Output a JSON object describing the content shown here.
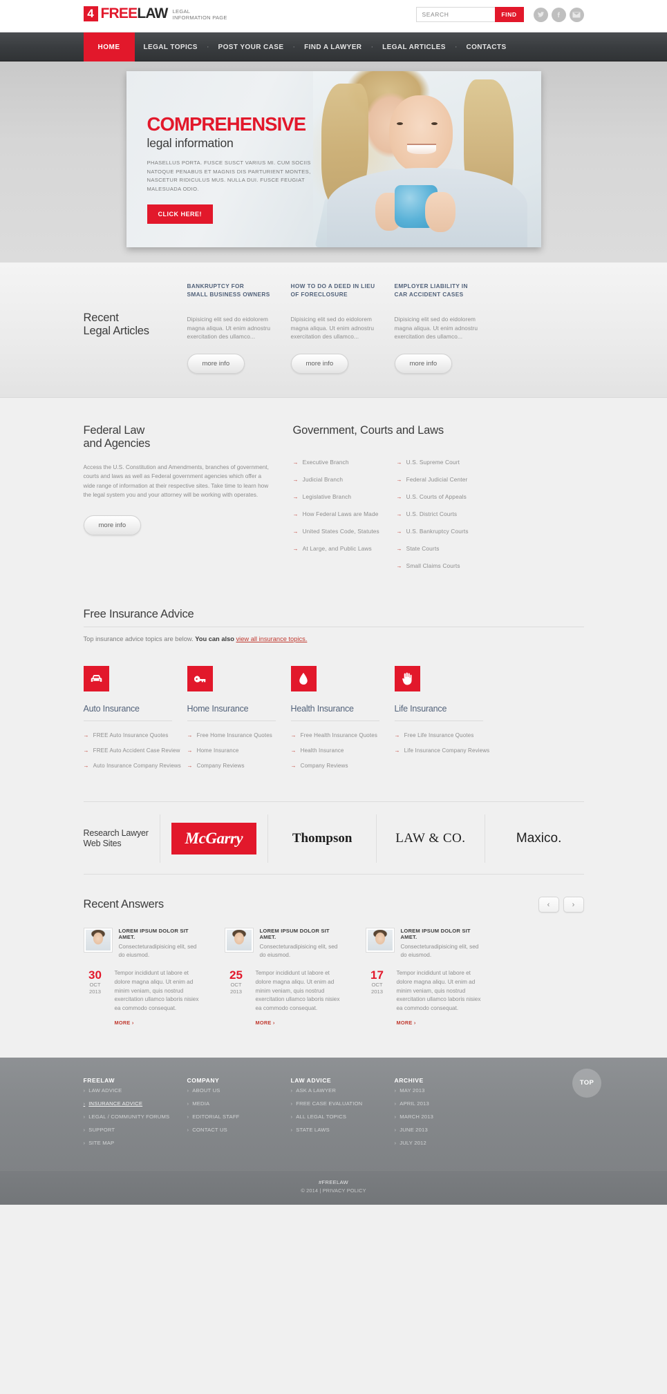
{
  "header": {
    "logo": {
      "mark": "4",
      "free": "FREE",
      "law": "LAW",
      "sub_line1": "LEGAL",
      "sub_line2": "INFORMATION PAGE"
    },
    "search": {
      "placeholder": "SEARCH",
      "value": "",
      "button": "FIND"
    },
    "social": [
      {
        "name": "twitter-icon",
        "label": "Twitter"
      },
      {
        "name": "facebook-icon",
        "label": "Facebook"
      },
      {
        "name": "email-icon",
        "label": "Email"
      }
    ]
  },
  "nav": {
    "home": "HOME",
    "items": [
      "LEGAL TOPICS",
      "POST YOUR CASE",
      "FIND A LAWYER",
      "LEGAL ARTICLES",
      "CONTACTS"
    ],
    "separator": "·"
  },
  "hero": {
    "heading": "COMPREHENSIVE",
    "subheading": "legal information",
    "paragraph": "PHASELLUS PORTA. FUSCE SUSCT VARIUS MI. CUM SOCIIS NATOQUE PENABUS ET MAGNIS DIS PARTURIENT MONTES, NASCETUR RIDICULUS MUS. NULLA DUI. FUSCE FEUGIAT MALESUADA ODIO.",
    "button": "CLICK HERE!"
  },
  "recent_articles": {
    "title_line1": "Recent",
    "title_line2": "Legal Articles",
    "items": [
      {
        "title_line1": "BANKRUPTCY FOR",
        "title_line2": "SMALL BUSINESS OWNERS",
        "body": "Dipisicing elit sed do eidolorem magna aliqua. Ut enim adnostru exercitation des ullamco...",
        "button": "more info"
      },
      {
        "title_line1": "HOW TO DO A DEED IN LIEU",
        "title_line2": "OF FORECLOSURE",
        "body": "Dipisicing elit sed do eidolorem magna aliqua. Ut enim adnostru exercitation des ullamco...",
        "button": "more info"
      },
      {
        "title_line1": "EMPLOYER LIABILITY IN",
        "title_line2": "CAR ACCIDENT CASES",
        "body": "Dipisicing elit sed do eidolorem magna aliqua. Ut enim adnostru exercitation des ullamco...",
        "button": "more info"
      }
    ]
  },
  "federal": {
    "title_line1": "Federal Law",
    "title_line2": "and Agencies",
    "paragraph": "Access the U.S. Constitution and Amendments, branches of government, courts and laws as well as Federal government agencies which offer a wide range of information at their respective sites. Take time to learn how the legal system you and your attorney will be working with operates.",
    "button": "more info"
  },
  "government": {
    "title": "Government, Courts and Laws",
    "column1": [
      "Executive Branch",
      "Judicial Branch",
      "Legislative Branch",
      "How Federal Laws are Made",
      "United States Code, Statutes",
      "At Large, and Public Laws"
    ],
    "column2": [
      "U.S. Supreme Court",
      "Federal Judicial Center",
      "U.S. Courts of Appeals",
      "U.S. District Courts",
      "U.S. Bankruptcy Courts",
      "State Courts",
      "Small Claims Courts"
    ]
  },
  "insurance": {
    "title": "Free Insurance Advice",
    "subtitle_plain": "Top insurance advice topics are below. ",
    "subtitle_bold": "You can also ",
    "subtitle_link": "view all insurance topics.",
    "cards": [
      {
        "icon": "car-icon",
        "name": "Auto Insurance",
        "links": [
          "FREE Auto Insurance Quotes",
          "FREE Auto Accident Case Review",
          "Auto Insurance Company Reviews"
        ]
      },
      {
        "icon": "key-icon",
        "name": "Home Insurance",
        "links": [
          "Free Home Insurance Quotes",
          "Home Insurance",
          "Company Reviews"
        ]
      },
      {
        "icon": "drop-icon",
        "name": "Health Insurance",
        "links": [
          "Free Health Insurance Quotes",
          "Health Insurance",
          "Company Reviews"
        ]
      },
      {
        "icon": "hand-icon",
        "name": "Life Insurance",
        "links": [
          "Free Life Insurance Quotes",
          "Life Insurance Company Reviews"
        ]
      }
    ]
  },
  "research": {
    "label_line1": "Research Lawyer",
    "label_line2": "Web Sites",
    "logos": [
      "McGarry",
      "Thompson",
      "LAW & CO.",
      "Maxico."
    ]
  },
  "answers": {
    "title": "Recent Answers",
    "prev": "‹",
    "next": "›",
    "items": [
      {
        "lead_title": "LOREM IPSUM DOLOR SIT AMET.",
        "lead_text": "Consecteturadipisicing elit, sed do eiusmod.",
        "day": "30",
        "month": "OCT",
        "year": "2013",
        "text": "Tempor incididunt ut labore et dolore magna aliqu. Ut enim ad minim veniam, quis nostrud exercitation ullamco laboris nisiex ea commodo consequat.",
        "more": "MORE ›"
      },
      {
        "lead_title": "LOREM IPSUM DOLOR SIT AMET.",
        "lead_text": "Consecteturadipisicing elit, sed do eiusmod.",
        "day": "25",
        "month": "OCT",
        "year": "2013",
        "text": "Tempor incididunt ut labore et dolore magna aliqu. Ut enim ad minim veniam, quis nostrud exercitation ullamco laboris nisiex ea commodo consequat.",
        "more": "MORE ›"
      },
      {
        "lead_title": "LOREM IPSUM DOLOR SIT AMET.",
        "lead_text": "Consecteturadipisicing elit, sed do eiusmod.",
        "day": "17",
        "month": "OCT",
        "year": "2013",
        "text": "Tempor incididunt ut labore et dolore magna aliqu. Ut enim ad minim veniam, quis nostrud exercitation ullamco laboris nisiex ea commodo consequat.",
        "more": "MORE ›"
      }
    ]
  },
  "footer": {
    "columns": [
      {
        "heading": "FREELAW",
        "links": [
          "LAW ADVICE",
          "INSURANCE ADVICE",
          "LEGAL / COMMUNITY FORUMS",
          "SUPPORT",
          "SITE MAP"
        ],
        "active_index": 1
      },
      {
        "heading": "COMPANY",
        "links": [
          "ABOUT US",
          "MEDIA",
          "EDITORIAL STAFF",
          "CONTACT US"
        ],
        "active_index": -1
      },
      {
        "heading": "LAW ADVICE",
        "links": [
          "ASK A LAWYER",
          "FREE CASE EVALUATION",
          "ALL LEGAL TOPICS",
          "STATE LAWS"
        ],
        "active_index": -1
      },
      {
        "heading": "ARCHIVE",
        "links": [
          "MAY 2013",
          "APRIL 2013",
          "MARCH 2013",
          "JUNE 2013",
          "JULY 2012"
        ],
        "active_index": -1
      }
    ],
    "top_button": "TOP",
    "brand": "#FREELAW",
    "copyright": "© 2014 | PRIVACY POLICY"
  },
  "colors": {
    "accent": "#e2182b",
    "nav_dark": "#3a3d40",
    "footer_gray": "#85888b",
    "heading_blue": "#52627a"
  }
}
